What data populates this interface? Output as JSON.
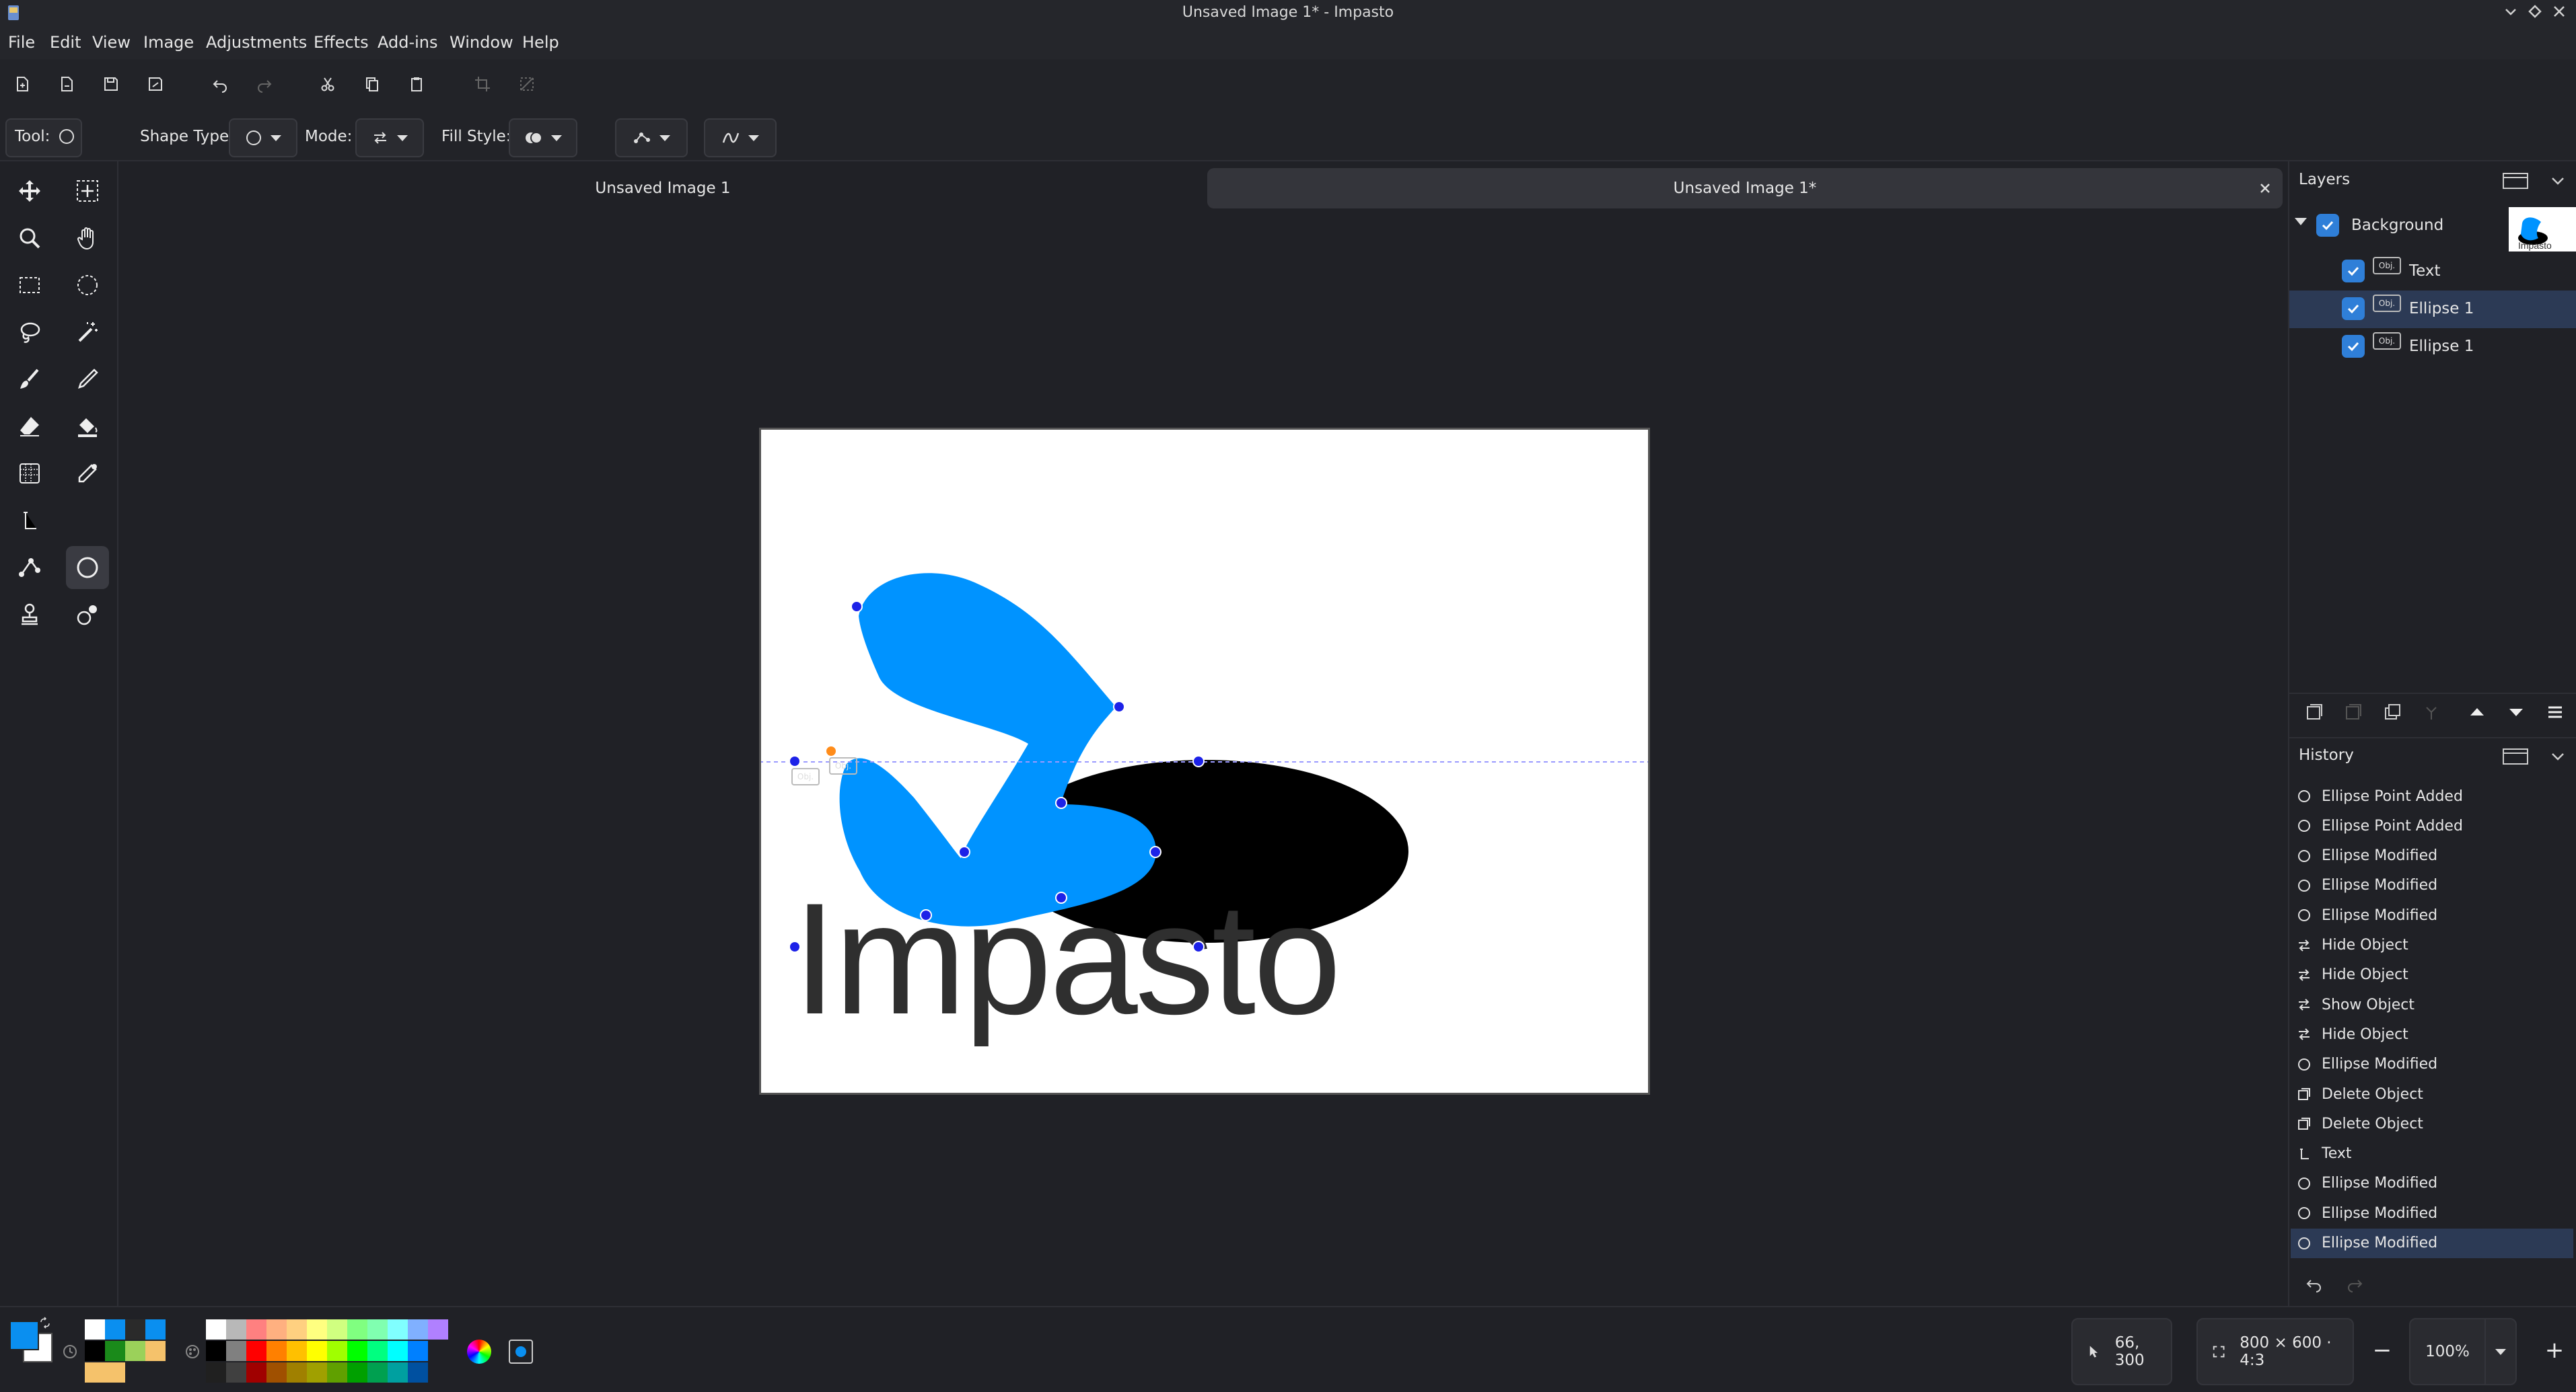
{
  "window": {
    "title": "Unsaved Image 1* - Impasto",
    "controls": [
      "minimize",
      "maximize",
      "close"
    ]
  },
  "menu": [
    "File",
    "Edit",
    "View",
    "Image",
    "Adjustments",
    "Effects",
    "Add-ins",
    "Window",
    "Help"
  ],
  "toolbar": {
    "buttons": [
      "new-icon",
      "open-icon",
      "save-icon",
      "save-as-icon",
      "undo-icon",
      "redo-icon",
      "cut-icon",
      "copy-icon",
      "paste-icon",
      "crop-icon",
      "deselect-icon"
    ]
  },
  "options": {
    "tool_label": "Tool:",
    "shape_type_label": "Shape Type:",
    "mode_label": "Mode:",
    "fill_style_label": "Fill Style:"
  },
  "tabs": [
    {
      "label": "Unsaved Image 1",
      "active": false
    },
    {
      "label": "Unsaved Image 1*",
      "active": true
    }
  ],
  "canvas": {
    "text": "Impasto",
    "background": "#ffffff",
    "ellipse_color": "#000000",
    "shape_color": "#0093ff",
    "text_color": "#2f2f2f"
  },
  "layers": {
    "title": "Layers",
    "items": [
      {
        "label": "Background",
        "checked": true,
        "level": 0
      },
      {
        "label": "Text",
        "checked": true,
        "level": 1
      },
      {
        "label": "Ellipse 1",
        "checked": true,
        "level": 1,
        "selected": true
      },
      {
        "label": "Ellipse 1",
        "checked": true,
        "level": 1
      }
    ],
    "obj_badge": "Obj."
  },
  "history": {
    "title": "History",
    "items": [
      {
        "label": "Ellipse Point Added",
        "icon": "ellipse-icon"
      },
      {
        "label": "Ellipse Point Added",
        "icon": "ellipse-icon"
      },
      {
        "label": "Ellipse Modified",
        "icon": "ellipse-icon"
      },
      {
        "label": "Ellipse Modified",
        "icon": "ellipse-icon"
      },
      {
        "label": "Ellipse Modified",
        "icon": "ellipse-icon"
      },
      {
        "label": "Hide Object",
        "icon": "mode-icon"
      },
      {
        "label": "Hide Object",
        "icon": "mode-icon"
      },
      {
        "label": "Show Object",
        "icon": "mode-icon"
      },
      {
        "label": "Hide Object",
        "icon": "mode-icon"
      },
      {
        "label": "Ellipse Modified",
        "icon": "ellipse-icon"
      },
      {
        "label": "Delete Object",
        "icon": "delete-layer-icon"
      },
      {
        "label": "Delete Object",
        "icon": "delete-layer-icon"
      },
      {
        "label": "Text",
        "icon": "text-tool-icon"
      },
      {
        "label": "Ellipse Modified",
        "icon": "ellipse-icon"
      },
      {
        "label": "Ellipse Modified",
        "icon": "ellipse-icon"
      },
      {
        "label": "Ellipse Modified",
        "icon": "ellipse-icon",
        "selected": true
      }
    ]
  },
  "status": {
    "cursor_position": "66, 300",
    "image_size": "800 × 600 · 4:3",
    "zoom": "100%",
    "zoom_out": "−",
    "zoom_in": "+"
  },
  "colors": {
    "primary": "#0a8ff0",
    "secondary": "#ffffff",
    "accent": "#2f7fd8",
    "selection": "#2c3a55"
  },
  "palette": {
    "recent": [
      "#ffffff",
      "#0a8ff0",
      "#2a2a2a",
      "#0a8ff0",
      "#000000",
      "#1a8a1a",
      "#9bd15a",
      "#f5c26b",
      "#f5c26b",
      "#f5c26b"
    ],
    "row1": [
      "#ffffff",
      "#b8b8b8",
      "#ff8080",
      "#ffb080",
      "#ffd080",
      "#ffff80",
      "#d0ff80",
      "#80ff80",
      "#80ffb0",
      "#80ffff",
      "#80b0ff",
      "#b080ff"
    ],
    "row2": [
      "#000000",
      "#808080",
      "#ff0000",
      "#ff8000",
      "#ffc000",
      "#ffff00",
      "#a0ff00",
      "#00ff00",
      "#00ff80",
      "#00ffff",
      "#0080ff"
    ],
    "row3": [
      "#202020",
      "#404040",
      "#a00000",
      "#a05000",
      "#a08000",
      "#a0a000",
      "#60a000",
      "#00a000",
      "#00a050",
      "#00a0a0",
      "#0050a0"
    ]
  }
}
